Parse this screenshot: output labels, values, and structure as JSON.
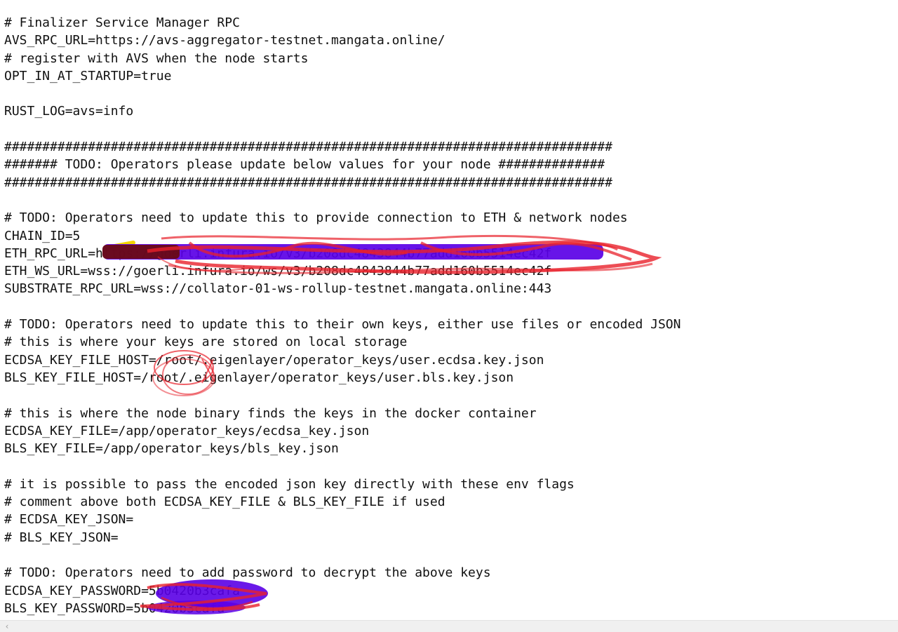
{
  "editor": {
    "lines": [
      "# Finalizer Service Manager RPC",
      "AVS_RPC_URL=https://avs-aggregator-testnet.mangata.online/",
      "# register with AVS when the node starts",
      "OPT_IN_AT_STARTUP=true",
      "",
      "RUST_LOG=avs=info",
      "",
      "################################################################################",
      "####### TODO: Operators please update below values for your node ##############",
      "################################################################################",
      "",
      "# TODO: Operators need to update this to provide connection to ETH & network nodes",
      "CHAIN_ID=5",
      "ETH_RPC_URL=https://goerli.infura.io/v3/b208dc4843844b77add160b5514ec42f",
      "ETH_WS_URL=wss://goerli.infura.io/ws/v3/b208dc4843844b77add160b5514ec42f",
      "SUBSTRATE_RPC_URL=wss://collator-01-ws-rollup-testnet.mangata.online:443",
      "",
      "# TODO: Operators need to update this to their own keys, either use files or encoded JSON",
      "# this is where your keys are stored on local storage",
      "ECDSA_KEY_FILE_HOST=/root/.eigenlayer/operator_keys/user.ecdsa.key.json",
      "BLS_KEY_FILE_HOST=/root/.eigenlayer/operator_keys/user.bls.key.json",
      "",
      "# this is where the node binary finds the keys in the docker container",
      "ECDSA_KEY_FILE=/app/operator_keys/ecdsa_key.json",
      "BLS_KEY_FILE=/app/operator_keys/bls_key.json",
      "",
      "# it is possible to pass the encoded json key directly with these env flags",
      "# comment above both ECDSA_KEY_FILE & BLS_KEY_FILE if used",
      "# ECDSA_KEY_JSON=",
      "# BLS_KEY_JSON=",
      "",
      "# TODO: Operators need to add password to decrypt the above keys",
      "ECDSA_KEY_PASSWORD=5b0420b3cafa",
      "BLS_KEY_PASSWORD=5b0420b3cafa"
    ]
  },
  "scrollbar": {
    "left_arrow": "‹"
  },
  "colors": {
    "redaction_purple": "#5a00e6",
    "redaction_red": "#e8202a",
    "redaction_yellow": "#f2d600",
    "redaction_dark": "#6a0a0a"
  }
}
